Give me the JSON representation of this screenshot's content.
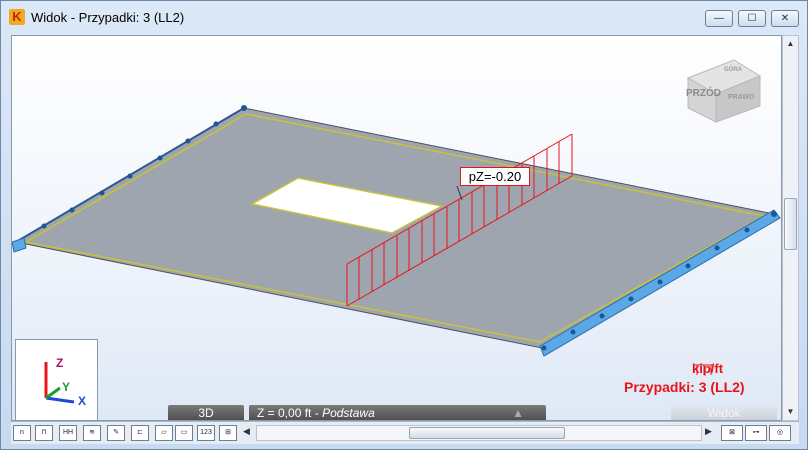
{
  "window": {
    "title": "Widok - Przypadki: 3 (LL2)",
    "app_icon_glyph": "K",
    "controls": {
      "minimize": "—",
      "maximize": "☐",
      "close": "✕"
    }
  },
  "view": {
    "view_cube_label": "PRZÓD",
    "view_cube_side": "PRAWO",
    "view_cube_top": "GÓRA",
    "load_label": "pZ=-0.20",
    "legend_unit": "kip/ft",
    "legend_case": "Przypadki: 3 (LL2)",
    "axes": {
      "z": "Z",
      "y": "Y",
      "x": "X"
    }
  },
  "status_bar": {
    "mode": "3D",
    "level_value": "Z = 0,00 ft",
    "level_name": "Podstawa",
    "view_button": "Widok"
  },
  "toolbar": {
    "buttons": [
      "n",
      "⊓",
      "HH",
      "≋",
      "✎",
      "⊏",
      "▱",
      "▭",
      "123",
      "⊞"
    ]
  },
  "colors": {
    "slab": "#9fa5ae",
    "slab_edge": "#c8c23a",
    "support": "#5aa8e6",
    "load": "#e8141c"
  }
}
